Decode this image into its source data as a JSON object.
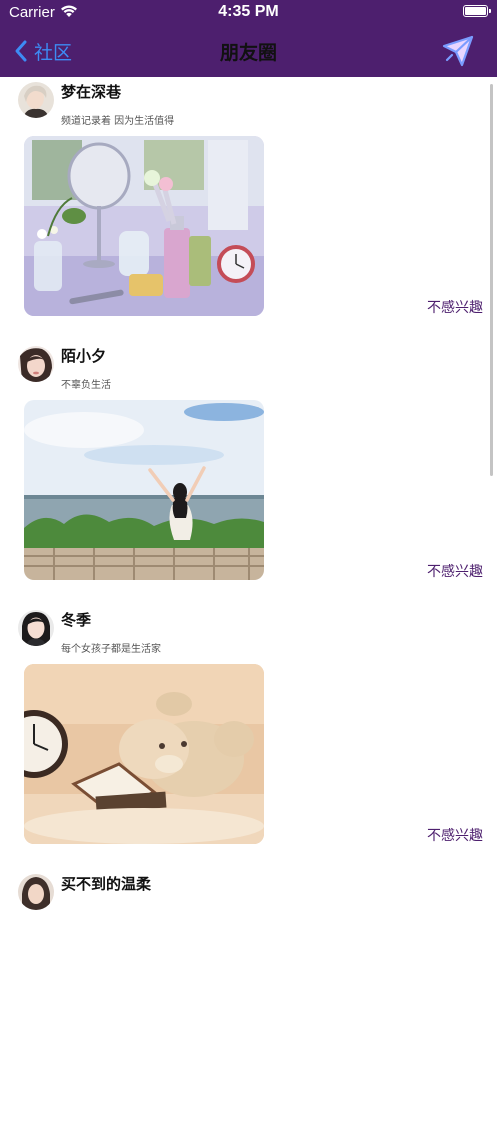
{
  "status_bar": {
    "carrier": "Carrier",
    "time": "4:35 PM"
  },
  "nav": {
    "back_label": "社区",
    "title": "朋友圈"
  },
  "posts": [
    {
      "name": "梦在深巷",
      "bio": "频道记录着 因为生活值得",
      "action": "不感兴趣",
      "photo": "perfume-still-life"
    },
    {
      "name": "陌小夕",
      "bio": "不辜负生活",
      "action": "不感兴趣",
      "photo": "seaside-girl"
    },
    {
      "name": "冬季",
      "bio": "每个女孩子都是生活家",
      "action": "不感兴趣",
      "photo": "plush-toy-clock"
    },
    {
      "name": "买不到的温柔"
    }
  ],
  "colors": {
    "nav_bg": "#4d1f6e",
    "link_blue": "#3d8bf4",
    "accent_purple": "#4d1f6e"
  }
}
